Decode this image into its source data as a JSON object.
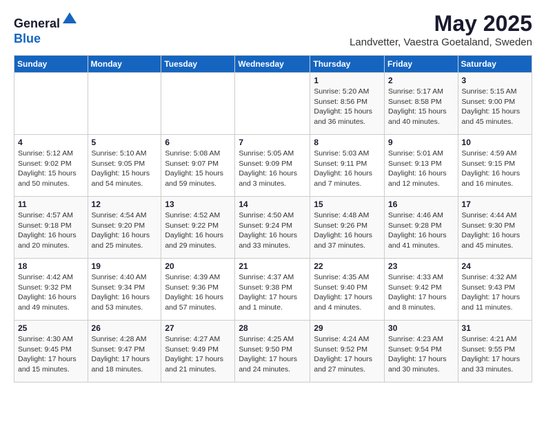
{
  "header": {
    "logo_line1": "General",
    "logo_line2": "Blue",
    "title": "May 2025",
    "subtitle": "Landvetter, Vaestra Goetaland, Sweden"
  },
  "columns": [
    "Sunday",
    "Monday",
    "Tuesday",
    "Wednesday",
    "Thursday",
    "Friday",
    "Saturday"
  ],
  "weeks": [
    [
      {
        "day": "",
        "info": ""
      },
      {
        "day": "",
        "info": ""
      },
      {
        "day": "",
        "info": ""
      },
      {
        "day": "",
        "info": ""
      },
      {
        "day": "1",
        "info": "Sunrise: 5:20 AM\nSunset: 8:56 PM\nDaylight: 15 hours\nand 36 minutes."
      },
      {
        "day": "2",
        "info": "Sunrise: 5:17 AM\nSunset: 8:58 PM\nDaylight: 15 hours\nand 40 minutes."
      },
      {
        "day": "3",
        "info": "Sunrise: 5:15 AM\nSunset: 9:00 PM\nDaylight: 15 hours\nand 45 minutes."
      }
    ],
    [
      {
        "day": "4",
        "info": "Sunrise: 5:12 AM\nSunset: 9:02 PM\nDaylight: 15 hours\nand 50 minutes."
      },
      {
        "day": "5",
        "info": "Sunrise: 5:10 AM\nSunset: 9:05 PM\nDaylight: 15 hours\nand 54 minutes."
      },
      {
        "day": "6",
        "info": "Sunrise: 5:08 AM\nSunset: 9:07 PM\nDaylight: 15 hours\nand 59 minutes."
      },
      {
        "day": "7",
        "info": "Sunrise: 5:05 AM\nSunset: 9:09 PM\nDaylight: 16 hours\nand 3 minutes."
      },
      {
        "day": "8",
        "info": "Sunrise: 5:03 AM\nSunset: 9:11 PM\nDaylight: 16 hours\nand 7 minutes."
      },
      {
        "day": "9",
        "info": "Sunrise: 5:01 AM\nSunset: 9:13 PM\nDaylight: 16 hours\nand 12 minutes."
      },
      {
        "day": "10",
        "info": "Sunrise: 4:59 AM\nSunset: 9:15 PM\nDaylight: 16 hours\nand 16 minutes."
      }
    ],
    [
      {
        "day": "11",
        "info": "Sunrise: 4:57 AM\nSunset: 9:18 PM\nDaylight: 16 hours\nand 20 minutes."
      },
      {
        "day": "12",
        "info": "Sunrise: 4:54 AM\nSunset: 9:20 PM\nDaylight: 16 hours\nand 25 minutes."
      },
      {
        "day": "13",
        "info": "Sunrise: 4:52 AM\nSunset: 9:22 PM\nDaylight: 16 hours\nand 29 minutes."
      },
      {
        "day": "14",
        "info": "Sunrise: 4:50 AM\nSunset: 9:24 PM\nDaylight: 16 hours\nand 33 minutes."
      },
      {
        "day": "15",
        "info": "Sunrise: 4:48 AM\nSunset: 9:26 PM\nDaylight: 16 hours\nand 37 minutes."
      },
      {
        "day": "16",
        "info": "Sunrise: 4:46 AM\nSunset: 9:28 PM\nDaylight: 16 hours\nand 41 minutes."
      },
      {
        "day": "17",
        "info": "Sunrise: 4:44 AM\nSunset: 9:30 PM\nDaylight: 16 hours\nand 45 minutes."
      }
    ],
    [
      {
        "day": "18",
        "info": "Sunrise: 4:42 AM\nSunset: 9:32 PM\nDaylight: 16 hours\nand 49 minutes."
      },
      {
        "day": "19",
        "info": "Sunrise: 4:40 AM\nSunset: 9:34 PM\nDaylight: 16 hours\nand 53 minutes."
      },
      {
        "day": "20",
        "info": "Sunrise: 4:39 AM\nSunset: 9:36 PM\nDaylight: 16 hours\nand 57 minutes."
      },
      {
        "day": "21",
        "info": "Sunrise: 4:37 AM\nSunset: 9:38 PM\nDaylight: 17 hours\nand 1 minute."
      },
      {
        "day": "22",
        "info": "Sunrise: 4:35 AM\nSunset: 9:40 PM\nDaylight: 17 hours\nand 4 minutes."
      },
      {
        "day": "23",
        "info": "Sunrise: 4:33 AM\nSunset: 9:42 PM\nDaylight: 17 hours\nand 8 minutes."
      },
      {
        "day": "24",
        "info": "Sunrise: 4:32 AM\nSunset: 9:43 PM\nDaylight: 17 hours\nand 11 minutes."
      }
    ],
    [
      {
        "day": "25",
        "info": "Sunrise: 4:30 AM\nSunset: 9:45 PM\nDaylight: 17 hours\nand 15 minutes."
      },
      {
        "day": "26",
        "info": "Sunrise: 4:28 AM\nSunset: 9:47 PM\nDaylight: 17 hours\nand 18 minutes."
      },
      {
        "day": "27",
        "info": "Sunrise: 4:27 AM\nSunset: 9:49 PM\nDaylight: 17 hours\nand 21 minutes."
      },
      {
        "day": "28",
        "info": "Sunrise: 4:25 AM\nSunset: 9:50 PM\nDaylight: 17 hours\nand 24 minutes."
      },
      {
        "day": "29",
        "info": "Sunrise: 4:24 AM\nSunset: 9:52 PM\nDaylight: 17 hours\nand 27 minutes."
      },
      {
        "day": "30",
        "info": "Sunrise: 4:23 AM\nSunset: 9:54 PM\nDaylight: 17 hours\nand 30 minutes."
      },
      {
        "day": "31",
        "info": "Sunrise: 4:21 AM\nSunset: 9:55 PM\nDaylight: 17 hours\nand 33 minutes."
      }
    ]
  ]
}
